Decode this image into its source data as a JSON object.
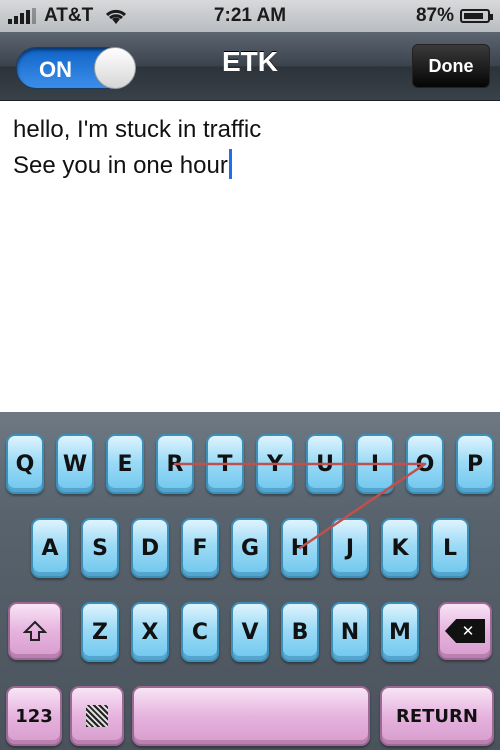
{
  "status_bar": {
    "carrier": "AT&T",
    "time": "7:21 AM",
    "battery_text": "87%",
    "battery_level": 0.87,
    "signal_bars": 4,
    "wifi_icon": "wifi-icon"
  },
  "nav_bar": {
    "toggle_label": "ON",
    "toggle_state": "on",
    "title": "ETK",
    "done_label": "Done"
  },
  "message": {
    "line1": "hello, I'm stuck in traffic",
    "line2": "See you in one hour"
  },
  "keyboard": {
    "row1": [
      "Q",
      "W",
      "E",
      "R",
      "T",
      "Y",
      "U",
      "I",
      "O",
      "P"
    ],
    "row2": [
      "A",
      "S",
      "D",
      "F",
      "G",
      "H",
      "J",
      "K",
      "L"
    ],
    "row3": [
      "Z",
      "X",
      "C",
      "V",
      "B",
      "N",
      "M"
    ],
    "shift_icon": "shift-arrow-icon",
    "delete_icon": "backspace-icon",
    "numbers_label": "123",
    "return_label": "RETURN",
    "swipe_path_keys": [
      "H",
      "O",
      "U",
      "R"
    ],
    "colors": {
      "letter_key": "#8fd3f3",
      "function_key": "#e3aedb",
      "swipe_line": "#c0504d"
    }
  }
}
